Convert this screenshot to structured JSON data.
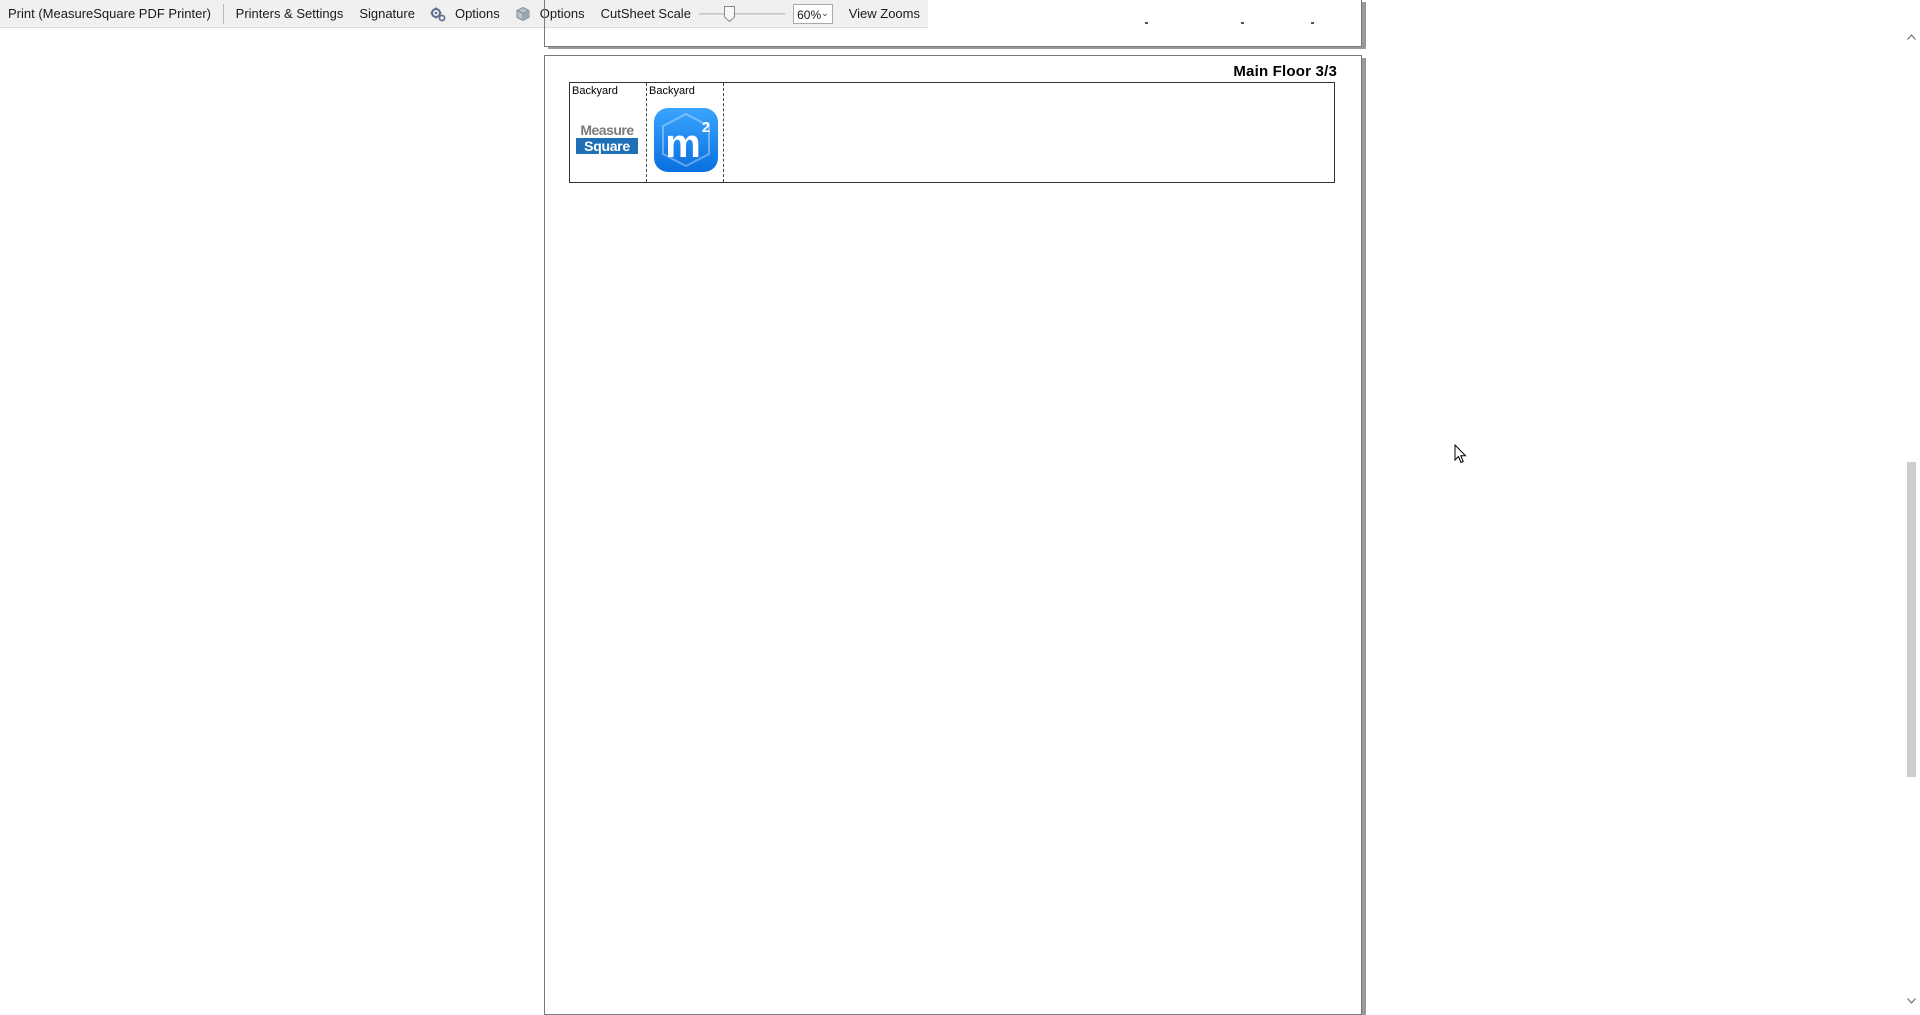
{
  "toolbar": {
    "print_label": "Print (MeasureSquare PDF Printer)",
    "printers_label": "Printers & Settings",
    "signature_label": "Signature",
    "options_label_1": "Options",
    "options_label_2": "Options",
    "cutsheet_scale_label": "CutSheet Scale",
    "cutsheet_scale_value": 0.2,
    "zoom_value": "60%",
    "view_zooms_label": "View Zooms",
    "options_icon_1": "gears-icon",
    "options_icon_2": "cube-icon"
  },
  "page": {
    "title": "Main Floor 3/3",
    "cells": [
      {
        "label": "Backyard",
        "image": "measuresquare-logo",
        "logo_line1": "Measure",
        "logo_line2": "Square"
      },
      {
        "label": "Backyard",
        "image": "m2-app-icon",
        "logo_text": "m",
        "logo_superscript": "2"
      }
    ]
  },
  "scrollbar": {
    "position_fraction": 0.66
  },
  "colors": {
    "toolbar_bg": "#f0f0f0",
    "logo_blue": "#1e6fb5",
    "app_icon_blue": "#1a8cff"
  }
}
